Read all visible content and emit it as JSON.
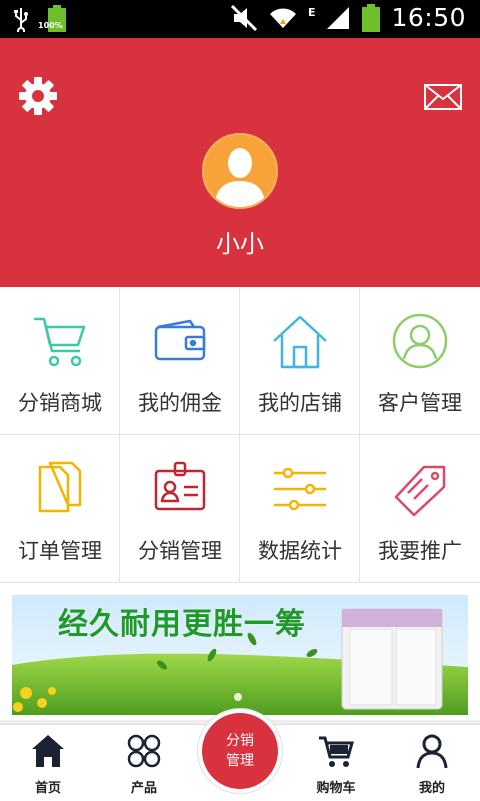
{
  "statusbar": {
    "time": "16:50",
    "battery_pct": "100%",
    "network": "E"
  },
  "header": {
    "username": "小小"
  },
  "grid": [
    {
      "label": "分销商城",
      "icon": "shopping-cart-icon"
    },
    {
      "label": "我的佣金",
      "icon": "wallet-icon"
    },
    {
      "label": "我的店铺",
      "icon": "house-icon"
    },
    {
      "label": "客户管理",
      "icon": "customer-icon"
    },
    {
      "label": "订单管理",
      "icon": "documents-icon"
    },
    {
      "label": "分销管理",
      "icon": "id-card-icon"
    },
    {
      "label": "数据统计",
      "icon": "sliders-icon"
    },
    {
      "label": "我要推广",
      "icon": "tag-icon"
    }
  ],
  "banner": {
    "headline": "经久耐用更胜一筹"
  },
  "tabbar": {
    "home": "首页",
    "products": "产品",
    "center_line1": "分销",
    "center_line2": "管理",
    "cart": "购物车",
    "mine": "我的"
  },
  "colors": {
    "brand_red": "#d9323f",
    "avatar_orange": "#f7a33a"
  }
}
